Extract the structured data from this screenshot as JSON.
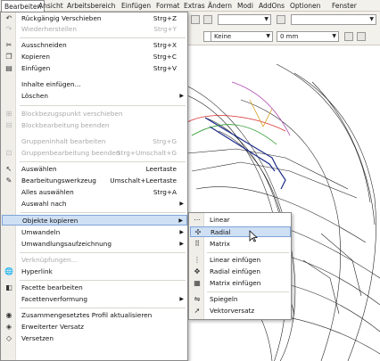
{
  "menubar": {
    "items": [
      "Bearbeiten",
      "Ansicht",
      "Arbeitsbereich",
      "Einfügen",
      "Format",
      "Extras",
      "Ändern",
      "Modi",
      "AddOns",
      "Optionen",
      "Fenster"
    ]
  },
  "toolbar": {
    "linetype": "Keine",
    "width": "0 mm"
  },
  "edit_menu": {
    "items": [
      {
        "icon": "undo-icon",
        "glyph": "↶",
        "label": "Rückgängig Verschieben",
        "shortcut": "Strg+Z",
        "disabled": false
      },
      {
        "icon": "redo-icon",
        "glyph": "↷",
        "label": "Wiederherstellen",
        "shortcut": "Strg+Y",
        "disabled": true
      },
      {
        "icon": "cut-icon",
        "glyph": "✂",
        "label": "Ausschneiden",
        "shortcut": "Strg+X",
        "disabled": false
      },
      {
        "icon": "copy-icon",
        "glyph": "❐",
        "label": "Kopieren",
        "shortcut": "Strg+C",
        "disabled": false
      },
      {
        "icon": "paste-icon",
        "glyph": "▤",
        "label": "Einfügen",
        "shortcut": "Strg+V",
        "disabled": false
      },
      {
        "icon": "",
        "glyph": "",
        "label": "Inhalte einfügen...",
        "shortcut": "",
        "disabled": false
      },
      {
        "icon": "",
        "glyph": "",
        "label": "Löschen",
        "shortcut": "",
        "disabled": false,
        "submenu": true
      },
      {
        "icon": "block-move-icon",
        "glyph": "⊞",
        "label": "Blockbezugspunkt verschieben",
        "shortcut": "",
        "disabled": true
      },
      {
        "icon": "block-end-icon",
        "glyph": "⊟",
        "label": "Blockbearbeitung beenden",
        "shortcut": "",
        "disabled": true
      },
      {
        "icon": "",
        "glyph": "",
        "label": "Gruppeninhalt bearbeiten",
        "shortcut": "Strg+G",
        "disabled": true
      },
      {
        "icon": "group-end-icon",
        "glyph": "⊡",
        "label": "Gruppenbearbeitung beenden",
        "shortcut": "Strg+Umschalt+G",
        "disabled": true
      },
      {
        "icon": "select-arrow-icon",
        "glyph": "↖",
        "label": "Auswählen",
        "shortcut": "Leertaste",
        "disabled": false
      },
      {
        "icon": "edit-tool-icon",
        "glyph": "✎",
        "label": "Bearbeitungswerkzeug",
        "shortcut": "Umschalt+Leertaste",
        "disabled": false
      },
      {
        "icon": "",
        "glyph": "",
        "label": "Alles auswählen",
        "shortcut": "Strg+A",
        "disabled": false
      },
      {
        "icon": "",
        "glyph": "",
        "label": "Auswahl nach",
        "shortcut": "",
        "disabled": false,
        "submenu": true
      },
      {
        "icon": "",
        "glyph": "",
        "label": "Objekte kopieren",
        "shortcut": "",
        "disabled": false,
        "submenu": true,
        "highlight": true
      },
      {
        "icon": "",
        "glyph": "",
        "label": "Umwandeln",
        "shortcut": "",
        "disabled": false,
        "submenu": true
      },
      {
        "icon": "",
        "glyph": "",
        "label": "Umwandlungsaufzeichnung",
        "shortcut": "",
        "disabled": false,
        "submenu": true
      },
      {
        "icon": "",
        "glyph": "",
        "label": "Verknüpfungen...",
        "shortcut": "",
        "disabled": true
      },
      {
        "icon": "hyperlink-icon",
        "glyph": "🌐",
        "label": "Hyperlink",
        "shortcut": "",
        "disabled": false
      },
      {
        "icon": "facet-edit-icon",
        "glyph": "◧",
        "label": "Facette bearbeiten",
        "shortcut": "",
        "disabled": false
      },
      {
        "icon": "",
        "glyph": "",
        "label": "Facettenverformung",
        "shortcut": "",
        "disabled": false,
        "submenu": true
      },
      {
        "icon": "profile-update-icon",
        "glyph": "◉",
        "label": "Zusammengesetztes Profil aktualisieren",
        "shortcut": "",
        "disabled": false
      },
      {
        "icon": "offset-extended-icon",
        "glyph": "◈",
        "label": "Erweiterter Versatz",
        "shortcut": "",
        "disabled": false
      },
      {
        "icon": "offset-icon",
        "glyph": "◇",
        "label": "Versetzen",
        "shortcut": "",
        "disabled": false
      }
    ]
  },
  "copy_submenu": {
    "items": [
      {
        "icon": "linear-icon",
        "glyph": "⋯",
        "label": "Linear"
      },
      {
        "icon": "radial-icon",
        "glyph": "✣",
        "label": "Radial",
        "highlight": true
      },
      {
        "icon": "matrix-icon",
        "glyph": "⠿",
        "label": "Matrix"
      },
      {
        "icon": "linear-insert-icon",
        "glyph": "⋮",
        "label": "Linear einfügen"
      },
      {
        "icon": "radial-insert-icon",
        "glyph": "✥",
        "label": "Radial einfügen"
      },
      {
        "icon": "matrix-insert-icon",
        "glyph": "▦",
        "label": "Matrix einfügen"
      },
      {
        "icon": "mirror-icon",
        "glyph": "⇋",
        "label": "Spiegeln"
      },
      {
        "icon": "vector-offset-icon",
        "glyph": "➚",
        "label": "Vektorversatz"
      }
    ]
  }
}
